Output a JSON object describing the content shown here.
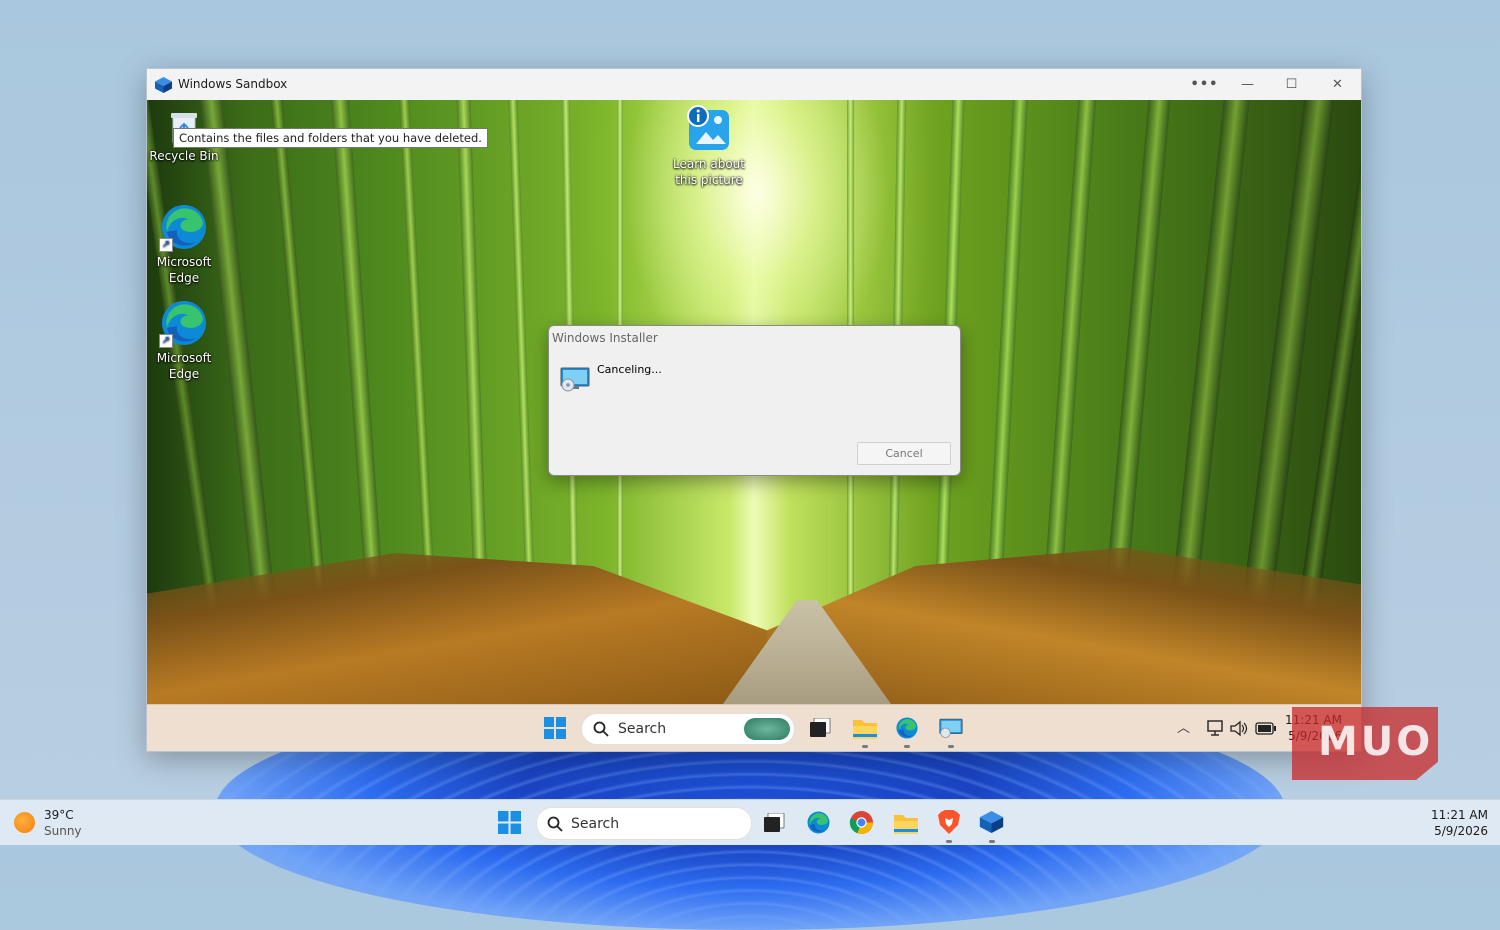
{
  "sandbox": {
    "title": "Windows Sandbox",
    "more_glyph": "•••",
    "minimize_glyph": "—",
    "maximize_glyph": "☐",
    "close_glyph": "✕"
  },
  "inner_desktop": {
    "tooltip": "Contains the files and folders that you have deleted.",
    "icons": [
      {
        "label": "Recycle Bin"
      },
      {
        "label": "Learn about this picture"
      },
      {
        "label": "Microsoft Edge"
      },
      {
        "label": "Microsoft Edge"
      }
    ]
  },
  "installer_dialog": {
    "title": "Windows Installer",
    "message": "Canceling...",
    "cancel_label": "Cancel"
  },
  "inner_taskbar": {
    "search_label": "Search",
    "time": "11:21 AM",
    "date": "5/9/2026",
    "accent": "#eedfd1"
  },
  "host_taskbar": {
    "weather_temp": "39°C",
    "weather_condition": "Sunny",
    "search_label": "Search",
    "time": "11:21 AM",
    "date": "5/9/2026"
  },
  "watermark": {
    "text": "MUO"
  },
  "colors": {
    "edge_blue": "#0c8ad6",
    "edge_green": "#38c36e",
    "windows_blue": "#0f6cbd",
    "folder_yellow": "#f8c33b",
    "brave_orange": "#fb542b"
  }
}
